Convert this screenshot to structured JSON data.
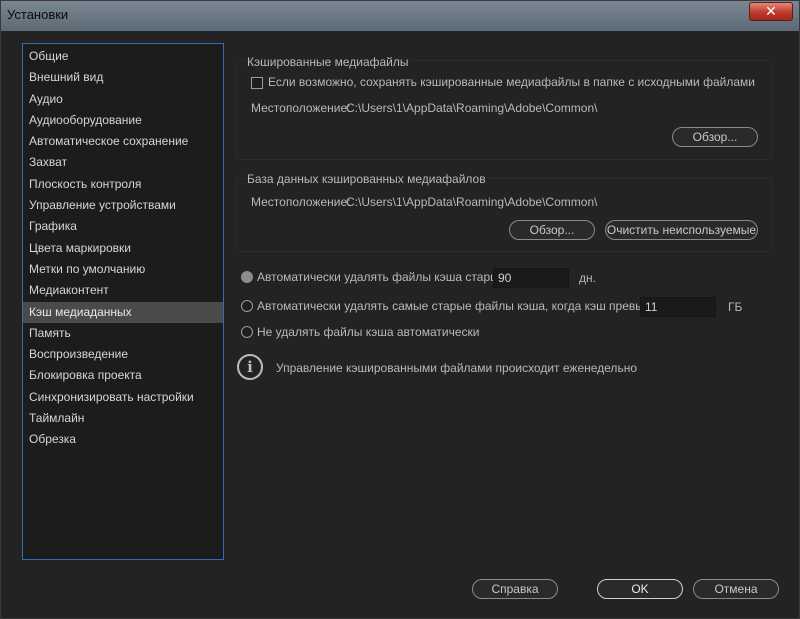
{
  "window": {
    "title": "Установки",
    "close_glyph": "✕"
  },
  "sidebar": {
    "items": [
      {
        "label": "Общие"
      },
      {
        "label": "Внешний вид"
      },
      {
        "label": "Аудио"
      },
      {
        "label": "Аудиооборудование"
      },
      {
        "label": "Автоматическое сохранение"
      },
      {
        "label": "Захват"
      },
      {
        "label": "Плоскость контроля"
      },
      {
        "label": "Управление устройствами"
      },
      {
        "label": "Графика"
      },
      {
        "label": "Цвета маркировки"
      },
      {
        "label": "Метки по умолчанию"
      },
      {
        "label": "Медиаконтент"
      },
      {
        "label": "Кэш медиаданных",
        "selected": true
      },
      {
        "label": "Память"
      },
      {
        "label": "Воспроизведение"
      },
      {
        "label": "Блокировка проекта"
      },
      {
        "label": "Синхронизировать настройки"
      },
      {
        "label": "Таймлайн"
      },
      {
        "label": "Обрезка"
      }
    ]
  },
  "cache_files": {
    "title": "Кэшированные медиафайлы",
    "checkbox_label": "Если возможно, сохранять кэшированные медиафайлы в папке с исходными файлами",
    "checkbox_checked": false,
    "location_label": "Местоположение:",
    "location_path": "C:\\Users\\1\\AppData\\Roaming\\Adobe\\Common\\",
    "browse_label": "Обзор..."
  },
  "cache_db": {
    "title": "База данных кэшированных медиафайлов",
    "location_label": "Местоположение:",
    "location_path": "C:\\Users\\1\\AppData\\Roaming\\Adobe\\Common\\",
    "browse_label": "Обзор...",
    "clean_label": "Очистить неиспользуемые"
  },
  "auto_delete": {
    "option_age_label": "Автоматически удалять файлы кэша старше:",
    "option_age_value": "90",
    "option_age_unit": "дн.",
    "option_size_label": "Автоматически удалять самые старые файлы кэша, когда кэш превышает:",
    "option_size_value": "11",
    "option_size_unit": "ГБ",
    "option_none_label": "Не удалять файлы кэша автоматически",
    "selected": "age"
  },
  "info": {
    "icon": "info-icon",
    "icon_glyph": "i",
    "message": "Управление кэшированными файлами происходит еженедельно"
  },
  "footer": {
    "help_label": "Справка",
    "ok_label": "OK",
    "cancel_label": "Отмена"
  }
}
